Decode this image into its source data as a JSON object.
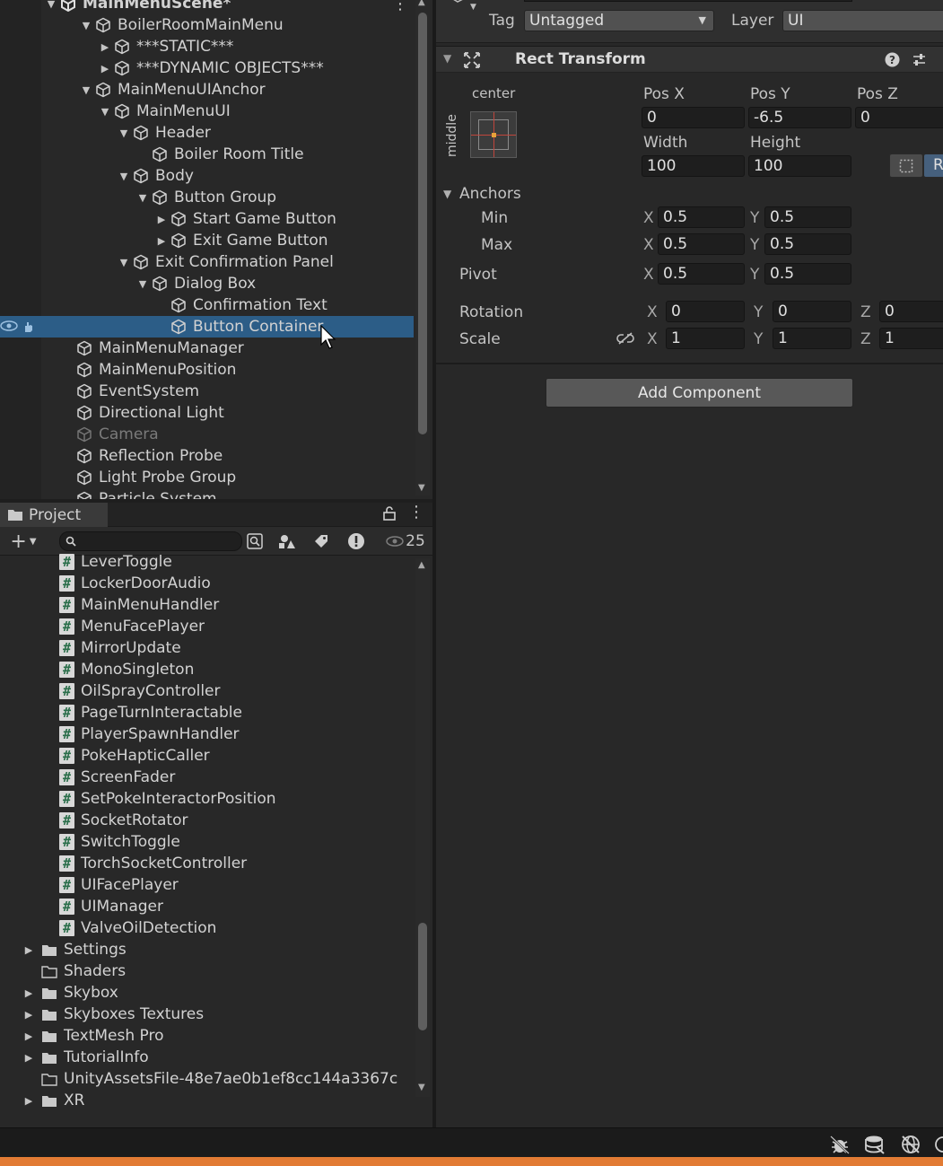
{
  "hierarchy": {
    "scene": "MainMenuScene*",
    "items": [
      {
        "label": "BoilerRoomMainMenu",
        "arrow": "▼"
      },
      {
        "label": "***STATIC***",
        "arrow": "▶"
      },
      {
        "label": "***DYNAMIC OBJECTS***",
        "arrow": "▶"
      },
      {
        "label": "MainMenuUIAnchor",
        "arrow": "▼"
      },
      {
        "label": "MainMenuUI",
        "arrow": "▼"
      },
      {
        "label": "Header",
        "arrow": "▼"
      },
      {
        "label": "Boiler Room Title",
        "arrow": ""
      },
      {
        "label": "Body",
        "arrow": "▼"
      },
      {
        "label": "Button Group",
        "arrow": "▼"
      },
      {
        "label": "Start Game Button",
        "arrow": "▶"
      },
      {
        "label": "Exit Game Button",
        "arrow": "▶"
      },
      {
        "label": "Exit Confirmation Panel",
        "arrow": "▼"
      },
      {
        "label": "Dialog Box",
        "arrow": "▼"
      },
      {
        "label": "Confirmation Text",
        "arrow": ""
      },
      {
        "label": "Button Container",
        "arrow": "",
        "selected": true
      },
      {
        "label": "MainMenuManager",
        "arrow": ""
      },
      {
        "label": "MainMenuPosition",
        "arrow": ""
      },
      {
        "label": "EventSystem",
        "arrow": ""
      },
      {
        "label": "Directional Light",
        "arrow": ""
      },
      {
        "label": "Camera",
        "arrow": "",
        "disabled": true
      },
      {
        "label": "Reflection Probe",
        "arrow": ""
      },
      {
        "label": "Light Probe Group",
        "arrow": ""
      },
      {
        "label": "Particle System",
        "arrow": ""
      }
    ]
  },
  "project": {
    "tab": "Project",
    "hidden_count": "25",
    "search": {
      "placeholder": ""
    },
    "scripts": [
      "LeverToggle",
      "LockerDoorAudio",
      "MainMenuHandler",
      "MenuFacePlayer",
      "MirrorUpdate",
      "MonoSingleton",
      "OilSprayController",
      "PageTurnInteractable",
      "PlayerSpawnHandler",
      "PokeHapticCaller",
      "ScreenFader",
      "SetPokeInteractorPosition",
      "SocketRotator",
      "SwitchToggle",
      "TorchSocketController",
      "UIFacePlayer",
      "UIManager",
      "ValveOilDetection"
    ],
    "folders": [
      {
        "label": "Settings",
        "arrow": "▶",
        "empty": false
      },
      {
        "label": "Shaders",
        "arrow": "",
        "empty": true
      },
      {
        "label": "Skybox",
        "arrow": "▶",
        "empty": false
      },
      {
        "label": "Skyboxes Textures",
        "arrow": "▶",
        "empty": false
      },
      {
        "label": "TextMesh Pro",
        "arrow": "▶",
        "empty": false
      },
      {
        "label": "TutorialInfo",
        "arrow": "▶",
        "empty": false
      },
      {
        "label": "UnityAssetsFile-48e7ae0b1ef8cc144a3367c",
        "arrow": "",
        "empty": true
      },
      {
        "label": "XR",
        "arrow": "▶",
        "empty": false
      }
    ]
  },
  "inspector": {
    "tag_label": "Tag",
    "tag_value": "Untagged",
    "layer_label": "Layer",
    "layer_value": "UI",
    "component_title": "Rect Transform",
    "anchor_preset_h": "center",
    "anchor_preset_v": "middle",
    "pos_x_label": "Pos X",
    "pos_x": "0",
    "pos_y_label": "Pos Y",
    "pos_y": "-6.5",
    "pos_z_label": "Pos Z",
    "pos_z": "0",
    "width_label": "Width",
    "width": "100",
    "height_label": "Height",
    "height": "100",
    "anchors_label": "Anchors",
    "min_label": "Min",
    "min_x": "0.5",
    "min_y": "0.5",
    "max_label": "Max",
    "max_x": "0.5",
    "max_y": "0.5",
    "pivot_label": "Pivot",
    "pivot_x": "0.5",
    "pivot_y": "0.5",
    "rotation_label": "Rotation",
    "rot_x": "0",
    "rot_y": "0",
    "rot_z": "0",
    "scale_label": "Scale",
    "scale_x": "1",
    "scale_y": "1",
    "scale_z": "1",
    "x_label": "X",
    "y_label": "Y",
    "z_label": "Z",
    "raw_button": "R",
    "add_component": "Add Component"
  },
  "colors": {
    "selection": "#2c5d87",
    "accent_bar": "#e27b34",
    "panel": "#282828"
  }
}
